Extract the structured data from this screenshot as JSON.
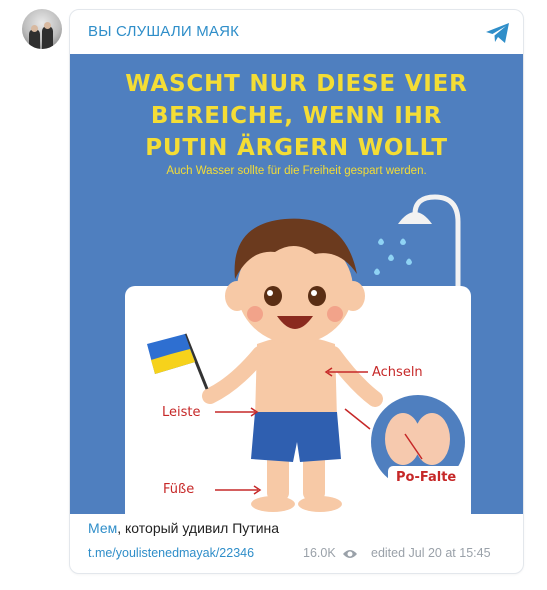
{
  "channel": {
    "name": "ВЫ СЛУШАЛИ МАЯК"
  },
  "image": {
    "headline": [
      "WASCHT NUR DIESE VIER",
      "BEREICHE, WENN IHR",
      "PUTIN ÄRGERN WOLLT"
    ],
    "subline": "Auch Wasser sollte für die Freiheit gespart werden.",
    "labels": {
      "armpits": "Achseln",
      "groin": "Leiste",
      "feet": "Füße",
      "butt": "Po-Falte"
    }
  },
  "caption": {
    "link_text": "Мем",
    "rest": ", который удивил Путина"
  },
  "meta": {
    "link": "t.me/youlistenedmayak/22346",
    "views": "16.0K",
    "edited": "edited  Jul 20 at 15:45"
  },
  "icons": {
    "telegram": "telegram-icon",
    "views": "eye-icon"
  },
  "colors": {
    "accent": "#2f8ec9",
    "image_bg": "#4f7fbf",
    "headline": "#f4dd35",
    "label": "#c62828"
  }
}
